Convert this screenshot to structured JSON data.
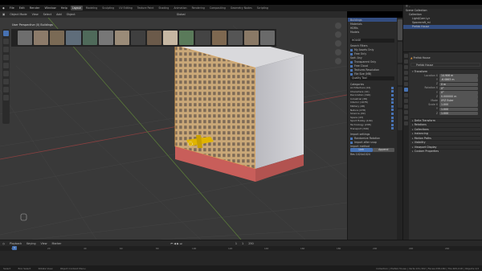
{
  "topbar": {
    "menus": [
      "File",
      "Edit",
      "Render",
      "Window",
      "Help"
    ],
    "workspaces": [
      "Layout",
      "Modeling",
      "Sculpting",
      "UV Editing",
      "Texture Paint",
      "Shading",
      "Animation",
      "Rendering",
      "Compositing",
      "Geometry Nodes",
      "Scripting"
    ],
    "active_workspace": "Layout",
    "scene": "Scene",
    "view_layer": "ViewLayer"
  },
  "viewport_header": {
    "mode": "Object Mode",
    "menus": [
      "View",
      "Select",
      "Add",
      "Object"
    ],
    "orientation": "Global"
  },
  "asset_strip": {
    "title": "User Perspective",
    "subtitle": "(0) Buildings",
    "thumb_colors": [
      "#6e6e6e",
      "#8c7b6a",
      "#7a6a55",
      "#5f6d7a",
      "#4f6a5a",
      "#777",
      "#9a8b78",
      "#3f3f3f",
      "#6b5a4a",
      "#c6b7a2",
      "#5a7a5a",
      "#444",
      "#7e6850",
      "#555",
      "#8a7966",
      "#6a6a6a"
    ]
  },
  "asset_panel": {
    "library_items": [
      "Buildings",
      "Materials",
      "HDRIs",
      "Models"
    ],
    "search_placeholder": "HOUSE",
    "filters": [
      "Search Filters",
      "My Assets Only",
      "Free Only"
    ],
    "sort_label": "Sort:",
    "sort_value": "Any",
    "options": [
      "Transparent Only",
      "Free Cloud",
      "Textures Resolution",
      "File Size (MB)"
    ],
    "quality_label": "Quality Tool",
    "categories_label": "Categories",
    "categories": [
      {
        "name": "Architecture (24)",
        "count": "24"
      },
      {
        "name": "Characters (10)",
        "count": "10"
      },
      {
        "name": "Decoration (190)",
        "count": "190"
      },
      {
        "name": "Industrial (38)",
        "count": "38"
      },
      {
        "name": "Interior (1078)",
        "count": "1078"
      },
      {
        "name": "Military (48)",
        "count": "48"
      },
      {
        "name": "Nature (478)",
        "count": "478"
      },
      {
        "name": "Science (49)",
        "count": "49"
      },
      {
        "name": "Space (43)",
        "count": "43"
      },
      {
        "name": "Sport Hobby (109)",
        "count": "109"
      },
      {
        "name": "Technology (298)",
        "count": "298"
      },
      {
        "name": "Transport (349)",
        "count": "349"
      }
    ],
    "import_label": "Import settings",
    "import_options": [
      "Randomize Rotation",
      "Import after snap"
    ],
    "import_method_label": "Import method",
    "import_methods": [
      "Link",
      "Append"
    ],
    "resolution_label": "Res",
    "resolution_value": "1024x1024"
  },
  "outliner": {
    "rows": [
      {
        "label": "Scene Collection",
        "selected": false
      },
      {
        "label": "Collection",
        "selected": false
      },
      {
        "label": "Light/Cam Lyr",
        "selected": false
      },
      {
        "label": "Spacecraft_mi",
        "selected": false
      },
      {
        "label": "Prefab House",
        "selected": true
      }
    ]
  },
  "properties": {
    "object_name": "Prefab House",
    "transform_label": "Transform",
    "fields": [
      {
        "label": "Location X",
        "value": "14.906 m"
      },
      {
        "label": "Y",
        "value": "-6.0863 m"
      },
      {
        "label": "Z",
        "value": "0 m"
      },
      {
        "label": "Rotation X",
        "value": "0°"
      },
      {
        "label": "Y",
        "value": "0°"
      },
      {
        "label": "Z",
        "value": "0.000000 m"
      },
      {
        "label": "Mode",
        "value": "XYZ Euler"
      },
      {
        "label": "Scale X",
        "value": "1.000"
      },
      {
        "label": "Y",
        "value": "1.000"
      },
      {
        "label": "Z",
        "value": "1.000"
      }
    ],
    "sections": [
      "Delta Transform",
      "Relations",
      "Collections",
      "Instancing",
      "Motion Paths",
      "Visibility",
      "Viewport Display",
      "Custom Properties"
    ]
  },
  "timeline": {
    "menus": [
      "Playback",
      "Keying",
      "View",
      "Marker"
    ],
    "current_frame": "1",
    "start": "1",
    "end": "250",
    "ticks": [
      "0",
      "20",
      "40",
      "60",
      "80",
      "100",
      "120",
      "140",
      "160",
      "180",
      "200",
      "220",
      "240"
    ]
  },
  "statusbar": {
    "left": [
      "Select",
      "Box Select",
      "Rotate View",
      "Object Context Menu"
    ],
    "right": "Collection | Prefab House | Verts:131,302 | Faces:238,180 | Tris:465,018 | Objects:1/3"
  },
  "colors": {
    "accent": "#4772b3",
    "building_facade": "#c9a777",
    "building_base": "#c85e5a",
    "building_side": "#c7c7cd"
  }
}
